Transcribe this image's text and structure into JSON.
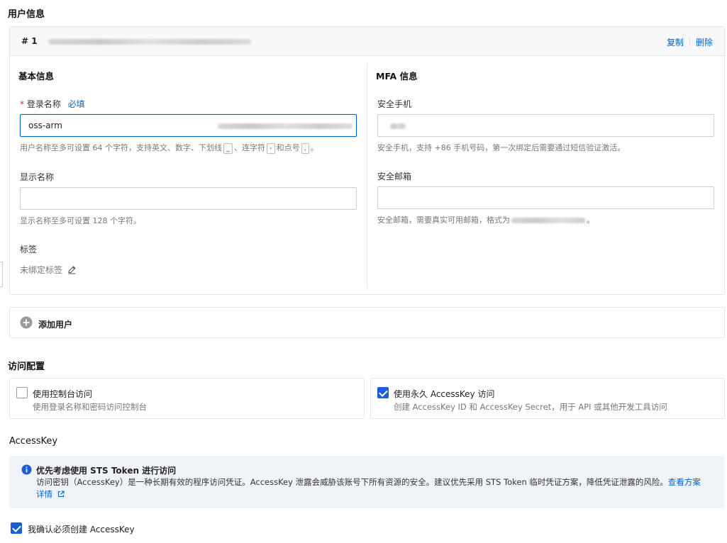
{
  "user_info": {
    "section_title": "用户信息",
    "user_index": "# 1",
    "copy_label": "复制",
    "delete_label": "删除",
    "basic": {
      "title": "基本信息",
      "login_required_mark": "*",
      "login_label": "登录名称",
      "login_must_fill": "必填",
      "login_value": "oss-arm",
      "login_hint_1": "用户名称至多可设置 64 个字符，支持英文、数字、下划线",
      "login_hint_kbd1": "_",
      "login_hint_2": "、连字符",
      "login_hint_kbd2": "-",
      "login_hint_3": "和点号",
      "login_hint_kbd3": ".",
      "login_hint_4": "。",
      "display_label": "显示名称",
      "display_value": "",
      "display_hint": "显示名称至多可设置 128 个字符。",
      "tags_label": "标签",
      "tags_value": "未绑定标签"
    },
    "mfa": {
      "title": "MFA 信息",
      "phone_label": "安全手机",
      "phone_hint": "安全手机，支持 +86 手机号码，第一次绑定后需要通过短信验证激活。",
      "email_label": "安全邮箱",
      "email_hint_prefix": "安全邮箱，需要真实可用邮箱，格式为",
      "email_hint_suffix": "。"
    },
    "add_user_label": "添加用户"
  },
  "access_config": {
    "section_title": "访问配置",
    "console": {
      "title": "使用控制台访问",
      "desc": "使用登录名称和密码访问控制台",
      "checked": false
    },
    "accesskey": {
      "title": "使用永久 AccessKey 访问",
      "desc": "创建 AccessKey ID 和 AccessKey Secret，用于 API 或其他开发工具访问",
      "checked": true
    }
  },
  "accesskey_section": {
    "title": "AccessKey",
    "notice_title": "优先考虑使用 STS Token 进行访问",
    "notice_body": "访问密钥（AccessKey）是一种长期有效的程序访问凭证。AccessKey 泄露会威胁该账号下所有资源的安全。建议优先采用 STS Token 临时凭证方案，降低凭证泄露的风险。",
    "notice_link_1": "查看方案",
    "notice_link_2": "详情",
    "confirm_label": "我确认必须创建 AccessKey",
    "confirm_checked": true
  },
  "colors": {
    "accent": "#0064c8",
    "checkbox": "#1a5fd6",
    "notice_bg": "#eff3f8"
  },
  "icons": {
    "edit": "pencil-icon",
    "add": "plus-circle-icon",
    "info": "info-icon",
    "external": "external-link-icon"
  }
}
